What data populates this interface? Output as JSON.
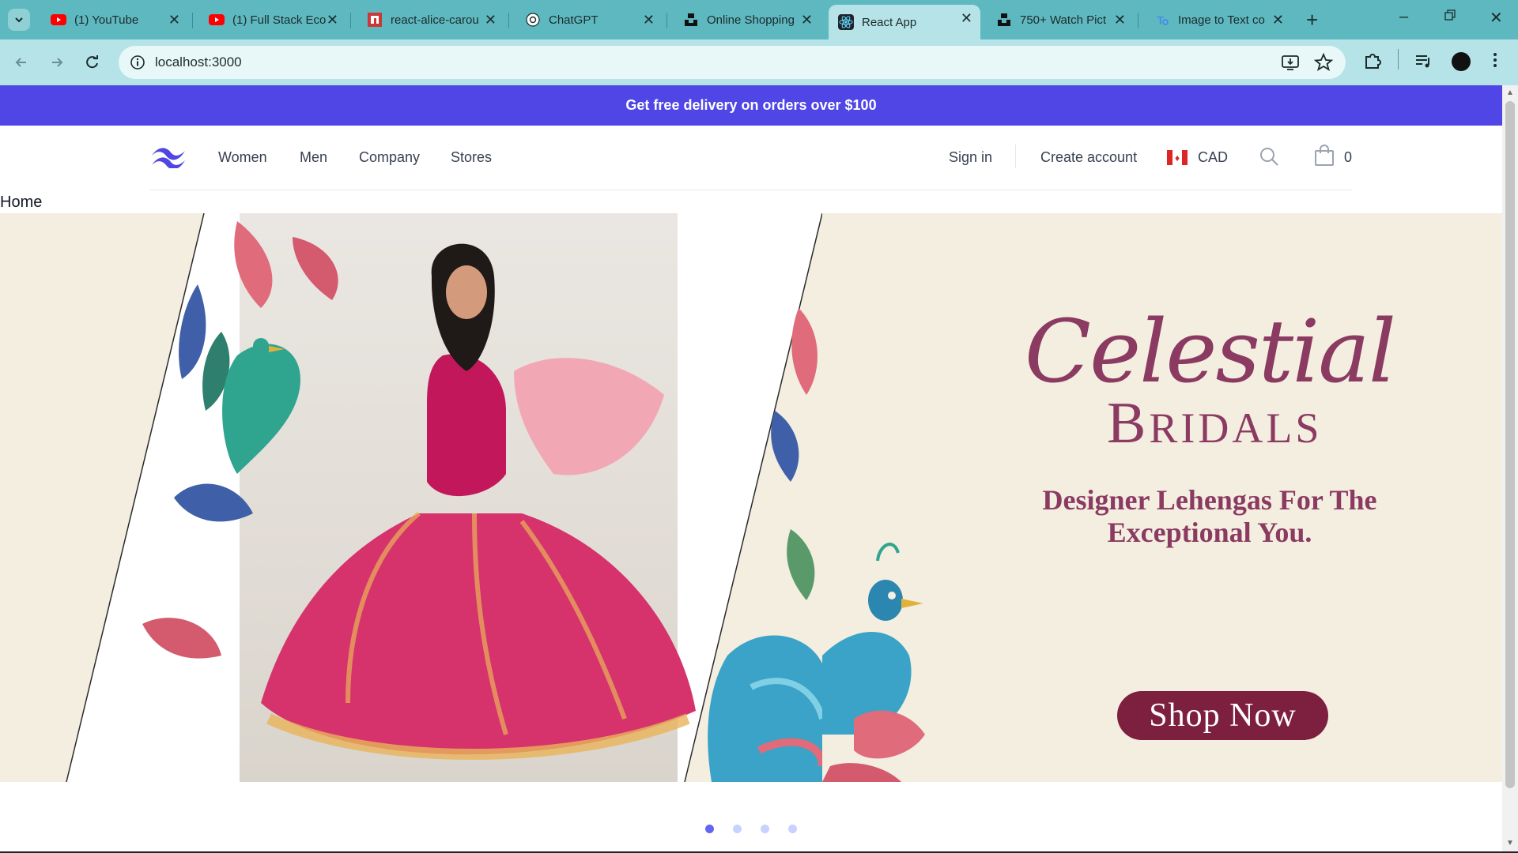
{
  "browser": {
    "tabs": [
      {
        "title": "(1) YouTube",
        "icon": "youtube-icon",
        "active": false
      },
      {
        "title": "(1) Full Stack Eco",
        "icon": "youtube-icon",
        "active": false
      },
      {
        "title": "react-alice-carou",
        "icon": "npm-icon",
        "active": false
      },
      {
        "title": "ChatGPT",
        "icon": "chatgpt-icon",
        "active": false
      },
      {
        "title": "Online Shopping",
        "icon": "unsplash-icon",
        "active": false
      },
      {
        "title": "React App",
        "icon": "react-icon",
        "active": true
      },
      {
        "title": "750+ Watch Pict",
        "icon": "unsplash-icon",
        "active": false
      },
      {
        "title": "Image to Text co",
        "icon": "translate-icon",
        "active": false
      }
    ],
    "url": "localhost:3000",
    "colors": {
      "tabstrip": "#5eb8bf",
      "toolbar": "#b5e3e7"
    }
  },
  "promo": {
    "text": "Get free delivery on orders over $100",
    "color": "#4f46e5"
  },
  "header": {
    "nav": [
      "Women",
      "Men",
      "Company",
      "Stores"
    ],
    "sign_in": "Sign in",
    "create_account": "Create account",
    "currency": "CAD",
    "cart_count": "0"
  },
  "breadcrumb": "Home",
  "hero": {
    "title": "Celestial",
    "subtitle_initial": "B",
    "subtitle_rest": "RIDALS",
    "tagline": "Designer Lehengas For The Exceptional You.",
    "cta": "Shop Now",
    "accent": "#8b3a62",
    "cta_color": "#7d1f3f"
  },
  "carousel": {
    "slide_count": 4,
    "active_index": 0
  }
}
